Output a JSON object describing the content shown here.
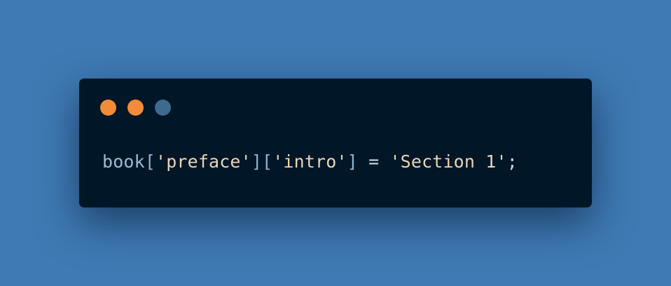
{
  "window": {
    "controls": [
      {
        "name": "close",
        "color": "#f28c38"
      },
      {
        "name": "minimize",
        "color": "#f28c38"
      },
      {
        "name": "maximize",
        "color": "#3e6a8f"
      }
    ]
  },
  "code": {
    "tokens": [
      {
        "text": "book",
        "color": "#9bbcd1"
      },
      {
        "text": "[",
        "color": "#8fb5d0"
      },
      {
        "text": "'preface'",
        "color": "#e8d6b5"
      },
      {
        "text": "][",
        "color": "#8fb5d0"
      },
      {
        "text": "'intro'",
        "color": "#e8d6b5"
      },
      {
        "text": "] ",
        "color": "#8fb5d0"
      },
      {
        "text": "=",
        "color": "#c9d8e6"
      },
      {
        "text": " ",
        "color": "#8fb5d0"
      },
      {
        "text": "'Section 1'",
        "color": "#e8d6b5"
      },
      {
        "text": ";",
        "color": "#c9d8e6"
      }
    ]
  }
}
